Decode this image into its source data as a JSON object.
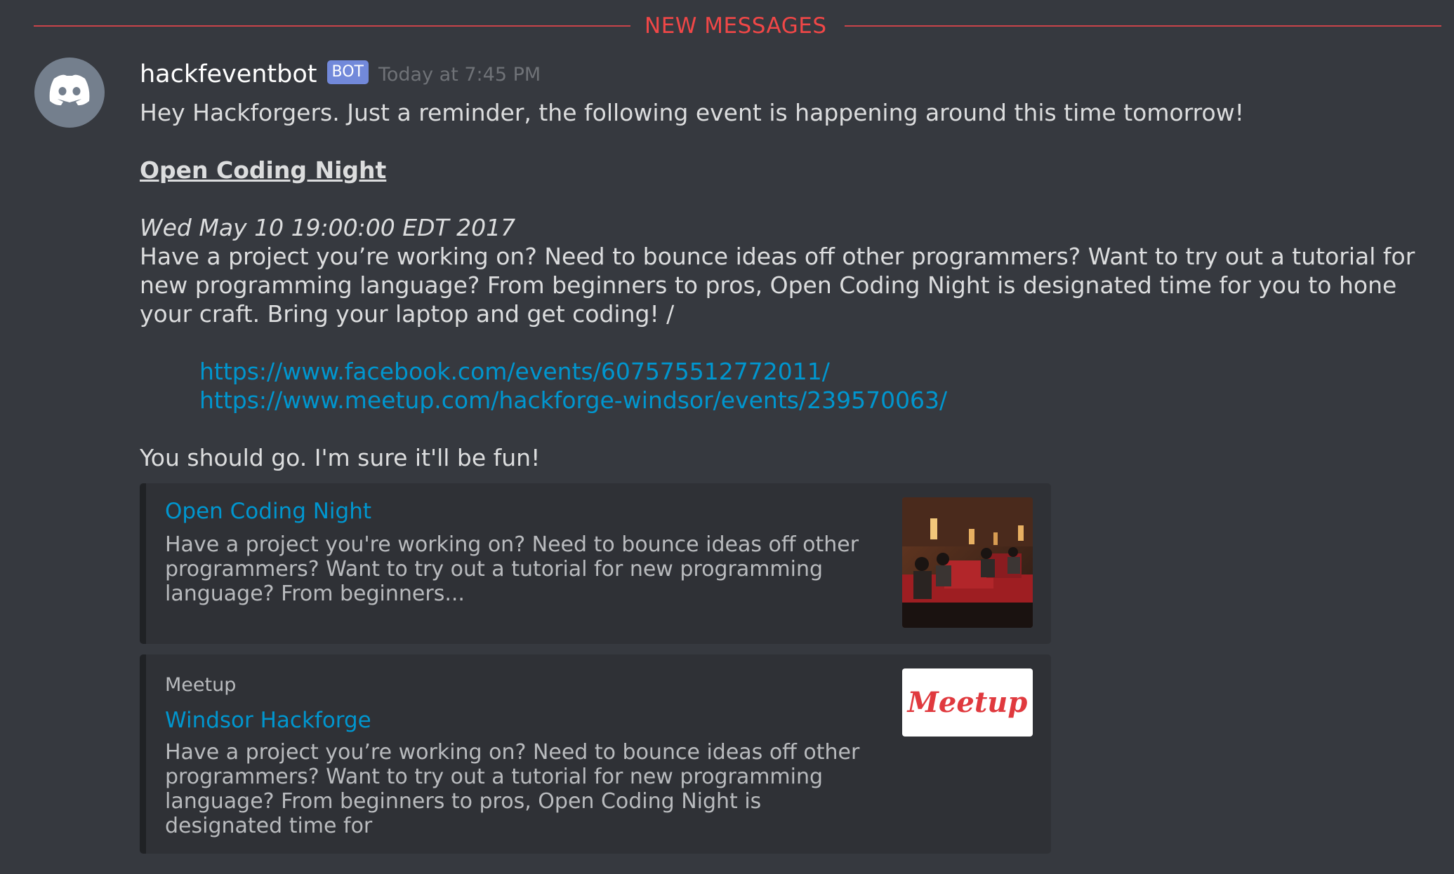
{
  "divider": {
    "label": "NEW MESSAGES"
  },
  "message": {
    "author": "hackfeventbot",
    "badge": "BOT",
    "timestamp": "Today at 7:45 PM",
    "intro": "Hey Hackforgers. Just a reminder, the following event is happening around this time tomorrow!",
    "event_title": "Open Coding Night",
    "event_date": "Wed May 10 19:00:00 EDT 2017",
    "event_description": "Have a project you’re working on? Need to bounce ideas off other programmers? Want to try out a tutorial for new programming language? From beginners to pros, Open Coding Night is designated time for you to hone your craft. Bring your laptop and get coding! /",
    "links": [
      "https://www.facebook.com/events/607575512772011/",
      "https://www.meetup.com/hackforge-windsor/events/239570063/"
    ],
    "outro": "You should go. I'm sure it'll be fun!"
  },
  "embeds": [
    {
      "title": "Open Coding Night",
      "description": "Have a project you're working on? Need to bounce ideas off other programmers? Want to try out a tutorial for new programming language? From beginners...",
      "thumbnail": "photo-thumbnail"
    },
    {
      "provider": "Meetup",
      "title": "Windsor Hackforge",
      "description": "Have a project you’re working on? Need to bounce ideas off other programmers? Want to try out a tutorial for new programming language? From beginners to pros, Open Coding Night is designated time for",
      "thumbnail_text": "Meetup"
    }
  ],
  "colors": {
    "background": "#36393f",
    "new_messages": "#f04747",
    "link": "#0096cf",
    "bot_badge": "#7289da",
    "meetup_red": "#e0393e"
  }
}
